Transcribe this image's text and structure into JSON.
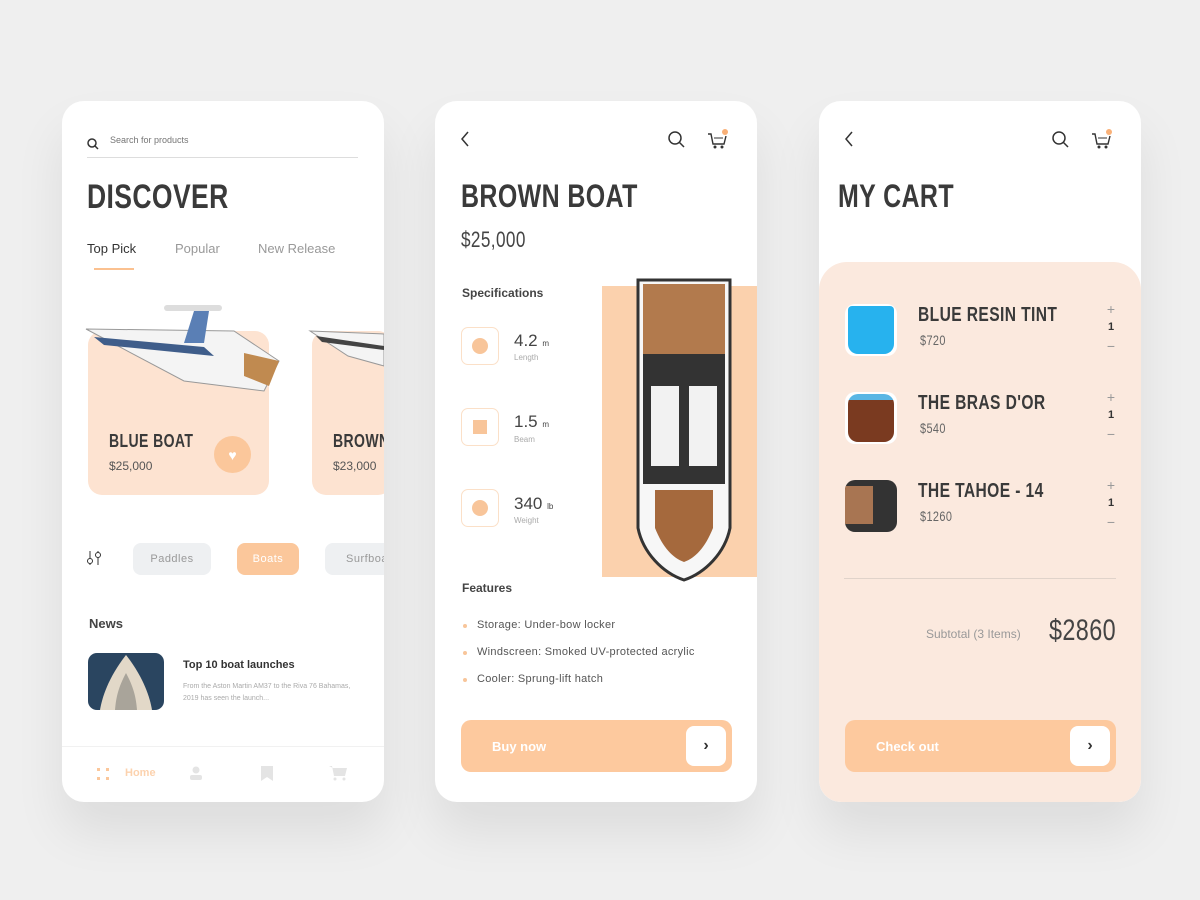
{
  "discover": {
    "search_placeholder": "Search for products",
    "title": "DISCOVER",
    "tabs": [
      "Top Pick",
      "Popular",
      "New Release"
    ],
    "products": [
      {
        "name": "BLUE BOAT",
        "price": "$25,000"
      },
      {
        "name": "BROWN BOAT",
        "price": "$23,000"
      }
    ],
    "categories": [
      "Paddles",
      "Boats",
      "Surfboards"
    ],
    "news_heading": "News",
    "news": {
      "title": "Top 10 boat launches",
      "excerpt": "From the Aston Martin AM37 to the Riva 76 Bahamas, 2019 has seen the launch..."
    },
    "nav": {
      "home": "Home"
    }
  },
  "detail": {
    "title": "BROWN BOAT",
    "price": "$25,000",
    "spec_heading": "Specifications",
    "specs": [
      {
        "value": "4.2",
        "unit": "m",
        "label": "Length"
      },
      {
        "value": "1.5",
        "unit": "m",
        "label": "Beam"
      },
      {
        "value": "340",
        "unit": "lb",
        "label": "Weight"
      }
    ],
    "features_heading": "Features",
    "features": [
      "Storage: Under-bow locker",
      "Windscreen: Smoked UV-protected acrylic",
      "Cooler: Sprung-lift hatch"
    ],
    "buy_label": "Buy now"
  },
  "cart": {
    "title": "MY CART",
    "items": [
      {
        "name": "BLUE RESIN TINT",
        "price": "$720",
        "qty": "1"
      },
      {
        "name": "THE BRAS D'OR",
        "price": "$540",
        "qty": "1"
      },
      {
        "name": "THE TAHOE - 14",
        "price": "$1260",
        "qty": "1"
      }
    ],
    "subtotal_label": "Subtotal (3 Items)",
    "subtotal": "$2860",
    "checkout_label": "Check out"
  },
  "colors": {
    "accent": "#fdc99e",
    "accent_light": "#fbe9de",
    "background": "#efefef"
  }
}
